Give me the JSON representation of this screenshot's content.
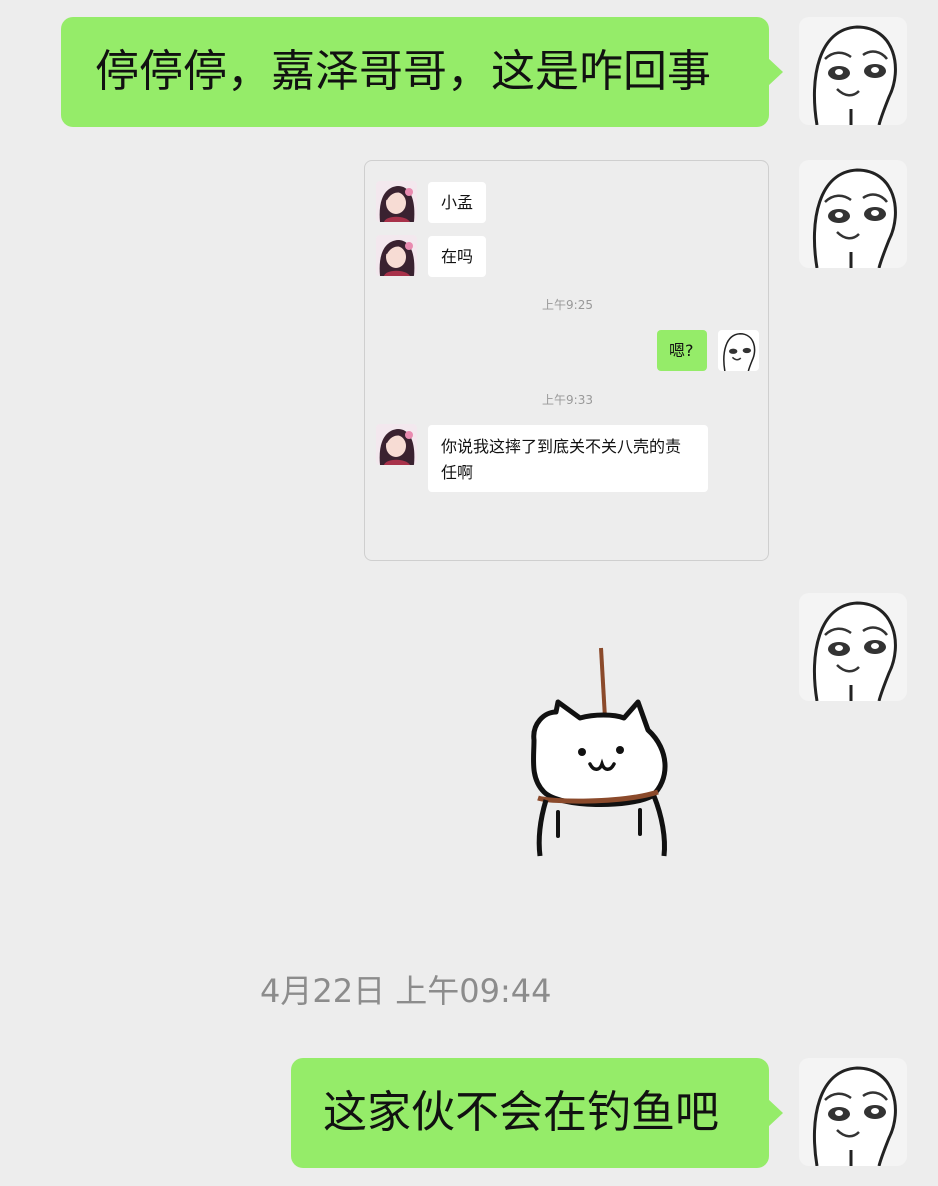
{
  "messages": [
    {
      "text": "停停停，嘉泽哥哥，这是咋回事"
    },
    {
      "text": "这家伙不会在钓鱼吧"
    }
  ],
  "embedded_chat": {
    "msg1": "小孟",
    "msg2": "在吗",
    "time1": "上午9:25",
    "reply": "嗯?",
    "time2": "上午9:33",
    "msg3_line1": "你说我这摔了到底关不关八壳的责",
    "msg3_line2": "任啊"
  },
  "timestamp": "4月22日 上午09:44",
  "icons": {
    "self_avatar": "meme-face-avatar",
    "other_avatar": "anime-girl-avatar",
    "sticker": "hanging-cat-sticker"
  },
  "colors": {
    "bubble_green": "#95ec69",
    "background": "#ededed"
  }
}
